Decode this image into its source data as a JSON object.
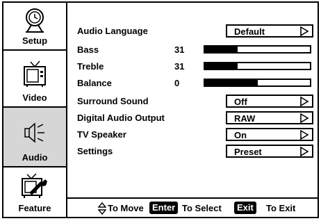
{
  "sidebar": {
    "tabs": [
      {
        "label": "Setup",
        "icon": "setup-icon",
        "active": false
      },
      {
        "label": "Video",
        "icon": "tv-icon",
        "active": false
      },
      {
        "label": "Audio",
        "icon": "speaker-icon",
        "active": true
      },
      {
        "label": "Feature",
        "icon": "tv-wrench-icon",
        "active": false
      }
    ]
  },
  "menu": {
    "audio_language": {
      "label": "Audio Language",
      "value": "Default"
    },
    "bass": {
      "label": "Bass",
      "value": "31",
      "level": 0.31
    },
    "treble": {
      "label": "Treble",
      "value": "31",
      "level": 0.31
    },
    "balance": {
      "label": "Balance",
      "value": "0",
      "level": 0.5
    },
    "surround": {
      "label": "Surround Sound",
      "value": "Off"
    },
    "digital_audio": {
      "label": "Digital Audio Output",
      "value": "RAW"
    },
    "tv_speaker": {
      "label": "TV Speaker",
      "value": "On"
    },
    "settings": {
      "label": "Settings",
      "value": "Preset"
    }
  },
  "footer": {
    "move_text": "To Move",
    "enter_key": "Enter",
    "select_text": "To Select",
    "exit_key": "Exit",
    "exit_text": "To Exit"
  },
  "colors": {
    "active_tab": "#d6d6d6",
    "foreground": "#000000",
    "background": "#ffffff"
  }
}
